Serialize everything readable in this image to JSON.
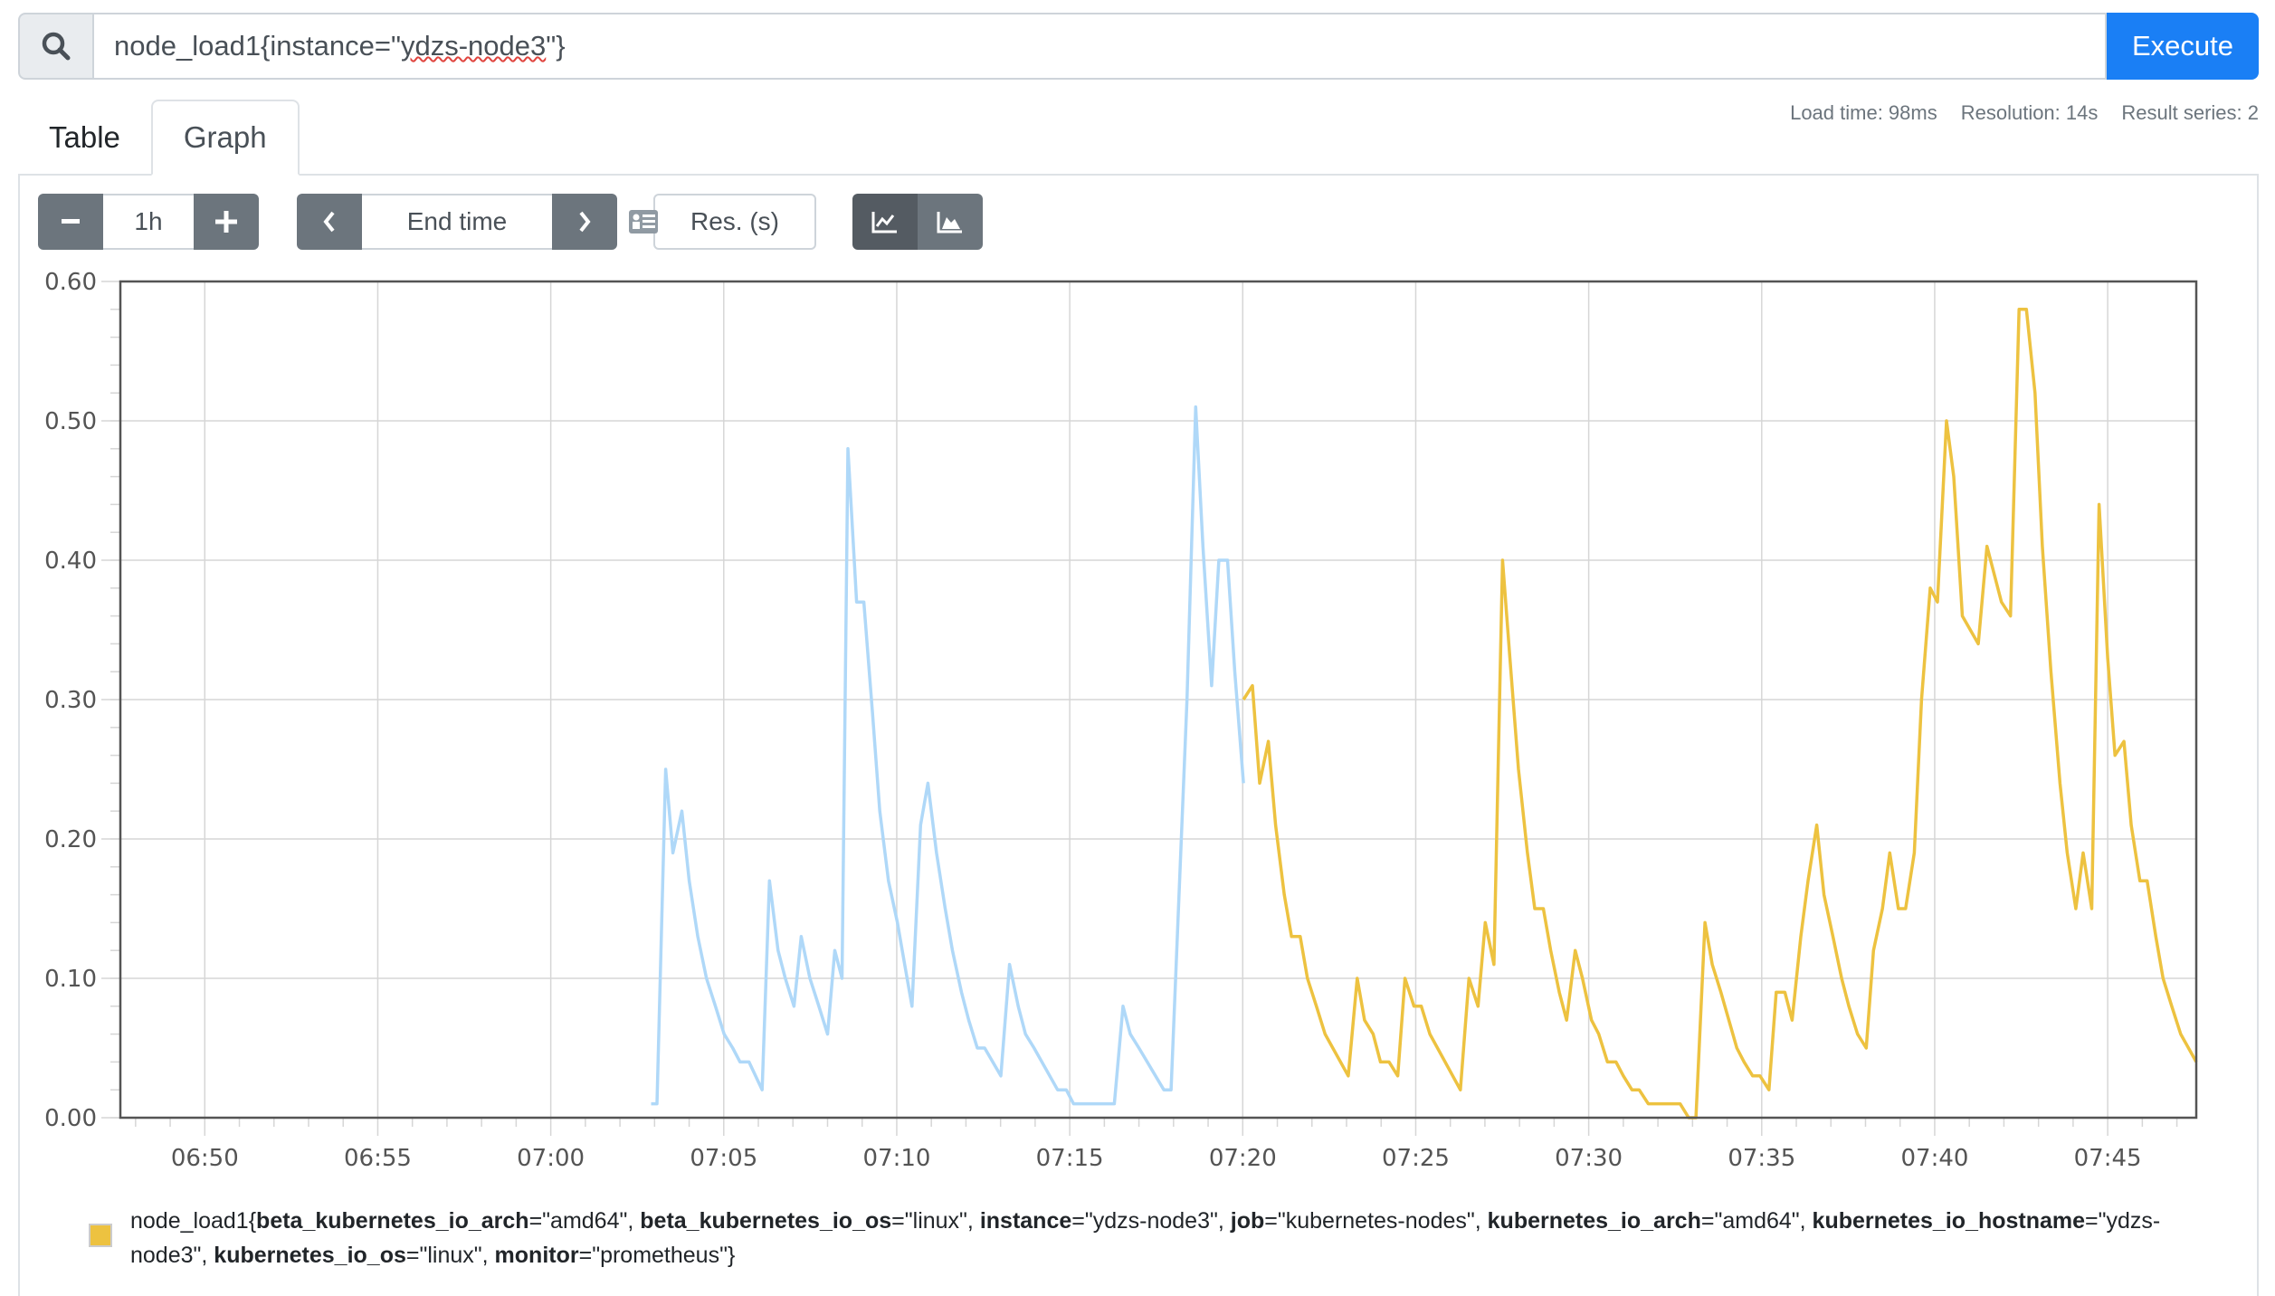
{
  "query": {
    "icon": "search-icon",
    "text_prefix": "node_load1{instance=\"",
    "text_underlined": "ydzs-node3",
    "text_suffix": "\"}",
    "execute_label": "Execute",
    "execute_color": "#1a7ff5"
  },
  "stats": {
    "load_time": "Load time: 98ms",
    "resolution": "Resolution: 14s",
    "result_series": "Result series: 2"
  },
  "tabs": [
    {
      "label": "Table",
      "active": false
    },
    {
      "label": "Graph",
      "active": true
    }
  ],
  "controls": {
    "range_minus": "−",
    "range_value": "1h",
    "range_plus": "+",
    "prev_icon": "chevron-left-icon",
    "end_time_placeholder": "End time",
    "calendar_icon": "calendar-icon",
    "next_icon": "chevron-right-icon",
    "res_placeholder": "Res. (s)",
    "line_mode_icon": "line-chart-icon",
    "stacked_mode_icon": "area-chart-icon",
    "active_mode": "line"
  },
  "legend": {
    "swatch_color": "#edc240",
    "metric": "node_load1",
    "labels": [
      {
        "key": "beta_kubernetes_io_arch",
        "value": "amd64"
      },
      {
        "key": "beta_kubernetes_io_os",
        "value": "linux"
      },
      {
        "key": "instance",
        "value": "ydzs-node3"
      },
      {
        "key": "job",
        "value": "kubernetes-nodes"
      },
      {
        "key": "kubernetes_io_arch",
        "value": "amd64"
      },
      {
        "key": "kubernetes_io_hostname",
        "value": "ydzs-node3"
      },
      {
        "key": "kubernetes_io_os",
        "value": "linux"
      },
      {
        "key": "monitor",
        "value": "prometheus"
      }
    ]
  },
  "chart_data": {
    "type": "line",
    "title": "",
    "xlabel": "",
    "ylabel": "",
    "x_unit": "minutes after 06:50",
    "xlim": [
      -2.44,
      57.56
    ],
    "ylim": [
      0,
      0.6
    ],
    "yticks": [
      "0.00",
      "0.10",
      "0.20",
      "0.30",
      "0.40",
      "0.50",
      "0.60"
    ],
    "ytick_values": [
      0,
      0.1,
      0.2,
      0.3,
      0.4,
      0.5,
      0.6
    ],
    "xticks": [
      "06:50",
      "06:55",
      "07:00",
      "07:05",
      "07:10",
      "07:15",
      "07:20",
      "07:25",
      "07:30",
      "07:35",
      "07:40",
      "07:45"
    ],
    "xtick_values": [
      0,
      5,
      10,
      15,
      20,
      25,
      30,
      35,
      40,
      45,
      50,
      55
    ],
    "grid": true,
    "legend_position": "bottom-left",
    "series": [
      {
        "name": "series-1",
        "color": "#afd8f8",
        "points": [
          [
            12.9,
            0.01
          ],
          [
            13.07,
            0.01
          ],
          [
            13.32,
            0.25
          ],
          [
            13.53,
            0.19
          ],
          [
            13.79,
            0.22
          ],
          [
            14.0,
            0.17
          ],
          [
            14.25,
            0.13
          ],
          [
            14.5,
            0.1
          ],
          [
            14.76,
            0.08
          ],
          [
            15.01,
            0.06
          ],
          [
            15.26,
            0.05
          ],
          [
            15.47,
            0.04
          ],
          [
            15.73,
            0.04
          ],
          [
            16.11,
            0.02
          ],
          [
            16.32,
            0.17
          ],
          [
            16.57,
            0.12
          ],
          [
            16.78,
            0.1
          ],
          [
            17.03,
            0.08
          ],
          [
            17.24,
            0.13
          ],
          [
            17.49,
            0.1
          ],
          [
            17.75,
            0.08
          ],
          [
            18.0,
            0.06
          ],
          [
            18.21,
            0.12
          ],
          [
            18.42,
            0.1
          ],
          [
            18.59,
            0.48
          ],
          [
            18.84,
            0.37
          ],
          [
            19.05,
            0.37
          ],
          [
            19.3,
            0.29
          ],
          [
            19.51,
            0.22
          ],
          [
            19.76,
            0.17
          ],
          [
            20.02,
            0.14
          ],
          [
            20.23,
            0.11
          ],
          [
            20.44,
            0.08
          ],
          [
            20.69,
            0.21
          ],
          [
            20.9,
            0.24
          ],
          [
            21.15,
            0.19
          ],
          [
            21.4,
            0.15
          ],
          [
            21.61,
            0.12
          ],
          [
            21.87,
            0.09
          ],
          [
            22.08,
            0.07
          ],
          [
            22.33,
            0.05
          ],
          [
            22.54,
            0.05
          ],
          [
            23.01,
            0.03
          ],
          [
            23.26,
            0.11
          ],
          [
            23.51,
            0.08
          ],
          [
            23.72,
            0.06
          ],
          [
            23.97,
            0.05
          ],
          [
            24.65,
            0.02
          ],
          [
            24.9,
            0.02
          ],
          [
            25.11,
            0.01
          ],
          [
            26.29,
            0.01
          ],
          [
            26.54,
            0.08
          ],
          [
            26.75,
            0.06
          ],
          [
            27.0,
            0.05
          ],
          [
            27.72,
            0.02
          ],
          [
            27.93,
            0.02
          ],
          [
            28.39,
            0.3
          ],
          [
            28.64,
            0.51
          ],
          [
            28.85,
            0.41
          ],
          [
            29.1,
            0.31
          ],
          [
            29.31,
            0.4
          ],
          [
            29.56,
            0.4
          ],
          [
            29.77,
            0.32
          ],
          [
            30.02,
            0.24
          ]
        ]
      },
      {
        "name": "node_load1",
        "color": "#edc240",
        "points": [
          [
            30.02,
            0.3
          ],
          [
            30.28,
            0.31
          ],
          [
            30.49,
            0.24
          ],
          [
            30.74,
            0.27
          ],
          [
            30.95,
            0.21
          ],
          [
            31.2,
            0.16
          ],
          [
            31.41,
            0.13
          ],
          [
            31.66,
            0.13
          ],
          [
            31.87,
            0.1
          ],
          [
            32.13,
            0.08
          ],
          [
            32.38,
            0.06
          ],
          [
            33.05,
            0.03
          ],
          [
            33.31,
            0.1
          ],
          [
            33.52,
            0.07
          ],
          [
            33.77,
            0.06
          ],
          [
            33.98,
            0.04
          ],
          [
            34.23,
            0.04
          ],
          [
            34.48,
            0.03
          ],
          [
            34.69,
            0.1
          ],
          [
            34.95,
            0.08
          ],
          [
            35.16,
            0.08
          ],
          [
            35.41,
            0.06
          ],
          [
            36.29,
            0.02
          ],
          [
            36.54,
            0.1
          ],
          [
            36.8,
            0.08
          ],
          [
            37.01,
            0.14
          ],
          [
            37.26,
            0.11
          ],
          [
            37.51,
            0.4
          ],
          [
            37.72,
            0.33
          ],
          [
            37.97,
            0.25
          ],
          [
            38.23,
            0.19
          ],
          [
            38.44,
            0.15
          ],
          [
            38.69,
            0.15
          ],
          [
            38.9,
            0.12
          ],
          [
            39.15,
            0.09
          ],
          [
            39.36,
            0.07
          ],
          [
            39.61,
            0.12
          ],
          [
            39.82,
            0.1
          ],
          [
            40.08,
            0.07
          ],
          [
            40.29,
            0.06
          ],
          [
            40.54,
            0.04
          ],
          [
            40.79,
            0.04
          ],
          [
            41.0,
            0.03
          ],
          [
            41.25,
            0.02
          ],
          [
            41.46,
            0.02
          ],
          [
            41.72,
            0.01
          ],
          [
            42.64,
            0.01
          ],
          [
            42.89,
            0.0
          ],
          [
            43.1,
            0.0
          ],
          [
            43.36,
            0.14
          ],
          [
            43.57,
            0.11
          ],
          [
            43.82,
            0.09
          ],
          [
            44.28,
            0.05
          ],
          [
            44.49,
            0.04
          ],
          [
            44.74,
            0.03
          ],
          [
            44.95,
            0.03
          ],
          [
            45.21,
            0.02
          ],
          [
            45.42,
            0.09
          ],
          [
            45.67,
            0.09
          ],
          [
            45.88,
            0.07
          ],
          [
            46.13,
            0.13
          ],
          [
            46.34,
            0.17
          ],
          [
            46.59,
            0.21
          ],
          [
            46.8,
            0.16
          ],
          [
            47.06,
            0.13
          ],
          [
            47.31,
            0.1
          ],
          [
            47.52,
            0.08
          ],
          [
            47.77,
            0.06
          ],
          [
            48.02,
            0.05
          ],
          [
            48.23,
            0.12
          ],
          [
            48.49,
            0.15
          ],
          [
            48.7,
            0.19
          ],
          [
            48.95,
            0.15
          ],
          [
            49.16,
            0.15
          ],
          [
            49.41,
            0.19
          ],
          [
            49.62,
            0.3
          ],
          [
            49.87,
            0.38
          ],
          [
            50.08,
            0.37
          ],
          [
            50.34,
            0.5
          ],
          [
            50.55,
            0.46
          ],
          [
            50.8,
            0.36
          ],
          [
            51.26,
            0.34
          ],
          [
            51.51,
            0.41
          ],
          [
            51.93,
            0.37
          ],
          [
            52.19,
            0.36
          ],
          [
            52.44,
            0.58
          ],
          [
            52.65,
            0.58
          ],
          [
            52.9,
            0.52
          ],
          [
            53.11,
            0.41
          ],
          [
            53.36,
            0.32
          ],
          [
            53.62,
            0.24
          ],
          [
            53.83,
            0.19
          ],
          [
            54.08,
            0.15
          ],
          [
            54.29,
            0.19
          ],
          [
            54.54,
            0.15
          ],
          [
            54.75,
            0.44
          ],
          [
            55.0,
            0.33
          ],
          [
            55.21,
            0.26
          ],
          [
            55.47,
            0.27
          ],
          [
            55.68,
            0.21
          ],
          [
            55.93,
            0.17
          ],
          [
            56.14,
            0.17
          ],
          [
            56.39,
            0.13
          ],
          [
            56.6,
            0.1
          ],
          [
            56.85,
            0.08
          ],
          [
            57.11,
            0.06
          ],
          [
            57.56,
            0.04
          ]
        ]
      }
    ]
  }
}
